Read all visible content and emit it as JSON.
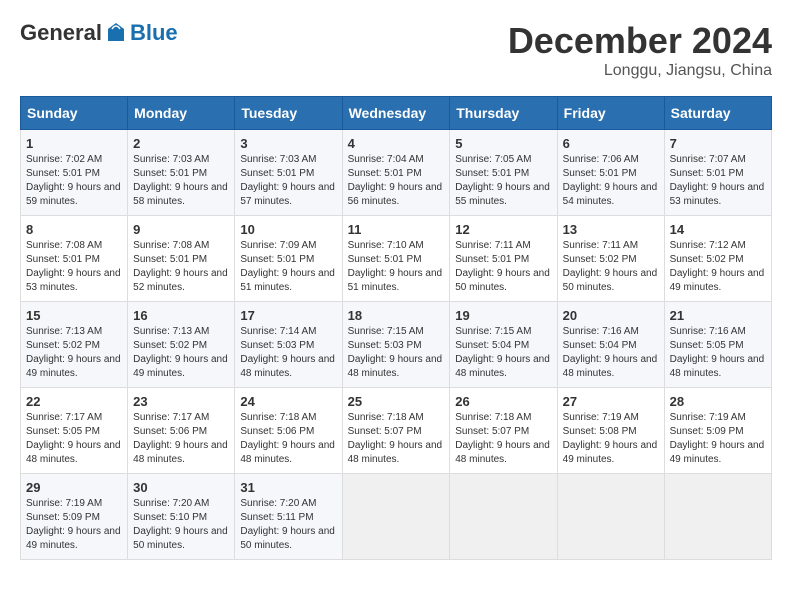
{
  "header": {
    "logo_general": "General",
    "logo_blue": "Blue",
    "month_title": "December 2024",
    "location": "Longgu, Jiangsu, China"
  },
  "weekdays": [
    "Sunday",
    "Monday",
    "Tuesday",
    "Wednesday",
    "Thursday",
    "Friday",
    "Saturday"
  ],
  "weeks": [
    [
      {
        "day": "1",
        "sunrise": "7:02 AM",
        "sunset": "5:01 PM",
        "daylight": "9 hours and 59 minutes."
      },
      {
        "day": "2",
        "sunrise": "7:03 AM",
        "sunset": "5:01 PM",
        "daylight": "9 hours and 58 minutes."
      },
      {
        "day": "3",
        "sunrise": "7:03 AM",
        "sunset": "5:01 PM",
        "daylight": "9 hours and 57 minutes."
      },
      {
        "day": "4",
        "sunrise": "7:04 AM",
        "sunset": "5:01 PM",
        "daylight": "9 hours and 56 minutes."
      },
      {
        "day": "5",
        "sunrise": "7:05 AM",
        "sunset": "5:01 PM",
        "daylight": "9 hours and 55 minutes."
      },
      {
        "day": "6",
        "sunrise": "7:06 AM",
        "sunset": "5:01 PM",
        "daylight": "9 hours and 54 minutes."
      },
      {
        "day": "7",
        "sunrise": "7:07 AM",
        "sunset": "5:01 PM",
        "daylight": "9 hours and 53 minutes."
      }
    ],
    [
      {
        "day": "8",
        "sunrise": "7:08 AM",
        "sunset": "5:01 PM",
        "daylight": "9 hours and 53 minutes."
      },
      {
        "day": "9",
        "sunrise": "7:08 AM",
        "sunset": "5:01 PM",
        "daylight": "9 hours and 52 minutes."
      },
      {
        "day": "10",
        "sunrise": "7:09 AM",
        "sunset": "5:01 PM",
        "daylight": "9 hours and 51 minutes."
      },
      {
        "day": "11",
        "sunrise": "7:10 AM",
        "sunset": "5:01 PM",
        "daylight": "9 hours and 51 minutes."
      },
      {
        "day": "12",
        "sunrise": "7:11 AM",
        "sunset": "5:01 PM",
        "daylight": "9 hours and 50 minutes."
      },
      {
        "day": "13",
        "sunrise": "7:11 AM",
        "sunset": "5:02 PM",
        "daylight": "9 hours and 50 minutes."
      },
      {
        "day": "14",
        "sunrise": "7:12 AM",
        "sunset": "5:02 PM",
        "daylight": "9 hours and 49 minutes."
      }
    ],
    [
      {
        "day": "15",
        "sunrise": "7:13 AM",
        "sunset": "5:02 PM",
        "daylight": "9 hours and 49 minutes."
      },
      {
        "day": "16",
        "sunrise": "7:13 AM",
        "sunset": "5:02 PM",
        "daylight": "9 hours and 49 minutes."
      },
      {
        "day": "17",
        "sunrise": "7:14 AM",
        "sunset": "5:03 PM",
        "daylight": "9 hours and 48 minutes."
      },
      {
        "day": "18",
        "sunrise": "7:15 AM",
        "sunset": "5:03 PM",
        "daylight": "9 hours and 48 minutes."
      },
      {
        "day": "19",
        "sunrise": "7:15 AM",
        "sunset": "5:04 PM",
        "daylight": "9 hours and 48 minutes."
      },
      {
        "day": "20",
        "sunrise": "7:16 AM",
        "sunset": "5:04 PM",
        "daylight": "9 hours and 48 minutes."
      },
      {
        "day": "21",
        "sunrise": "7:16 AM",
        "sunset": "5:05 PM",
        "daylight": "9 hours and 48 minutes."
      }
    ],
    [
      {
        "day": "22",
        "sunrise": "7:17 AM",
        "sunset": "5:05 PM",
        "daylight": "9 hours and 48 minutes."
      },
      {
        "day": "23",
        "sunrise": "7:17 AM",
        "sunset": "5:06 PM",
        "daylight": "9 hours and 48 minutes."
      },
      {
        "day": "24",
        "sunrise": "7:18 AM",
        "sunset": "5:06 PM",
        "daylight": "9 hours and 48 minutes."
      },
      {
        "day": "25",
        "sunrise": "7:18 AM",
        "sunset": "5:07 PM",
        "daylight": "9 hours and 48 minutes."
      },
      {
        "day": "26",
        "sunrise": "7:18 AM",
        "sunset": "5:07 PM",
        "daylight": "9 hours and 48 minutes."
      },
      {
        "day": "27",
        "sunrise": "7:19 AM",
        "sunset": "5:08 PM",
        "daylight": "9 hours and 49 minutes."
      },
      {
        "day": "28",
        "sunrise": "7:19 AM",
        "sunset": "5:09 PM",
        "daylight": "9 hours and 49 minutes."
      }
    ],
    [
      {
        "day": "29",
        "sunrise": "7:19 AM",
        "sunset": "5:09 PM",
        "daylight": "9 hours and 49 minutes."
      },
      {
        "day": "30",
        "sunrise": "7:20 AM",
        "sunset": "5:10 PM",
        "daylight": "9 hours and 50 minutes."
      },
      {
        "day": "31",
        "sunrise": "7:20 AM",
        "sunset": "5:11 PM",
        "daylight": "9 hours and 50 minutes."
      },
      null,
      null,
      null,
      null
    ]
  ],
  "labels": {
    "sunrise": "Sunrise:",
    "sunset": "Sunset:",
    "daylight": "Daylight hours"
  }
}
